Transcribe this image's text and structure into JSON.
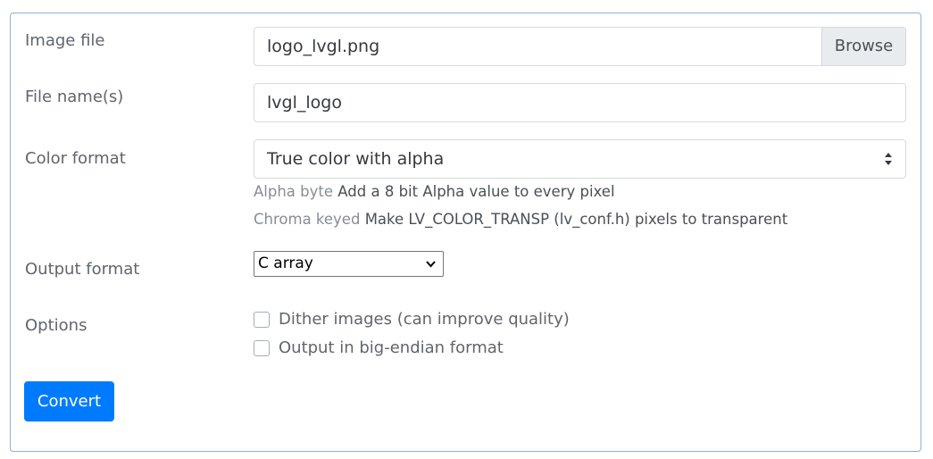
{
  "form": {
    "image_file": {
      "label": "Image file",
      "value": "logo_lvgl.png",
      "browse_label": "Browse"
    },
    "file_name": {
      "label": "File name(s)",
      "value": "lvgl_logo"
    },
    "color_format": {
      "label": "Color format",
      "selected": "True color with alpha",
      "help": [
        {
          "term": "Alpha byte",
          "text": "Add a 8 bit Alpha value to every pixel"
        },
        {
          "term": "Chroma keyed",
          "text": "Make LV_COLOR_TRANSP (lv_conf.h) pixels to transparent"
        }
      ]
    },
    "output_format": {
      "label": "Output format",
      "selected": "C array"
    },
    "options": {
      "label": "Options",
      "items": [
        {
          "label": "Dither images (can improve quality)",
          "checked": false
        },
        {
          "label": "Output in big-endian format",
          "checked": false
        }
      ]
    },
    "convert_label": "Convert"
  },
  "colors": {
    "primary": "#007bff",
    "panel_border": "#8fb1d5"
  }
}
